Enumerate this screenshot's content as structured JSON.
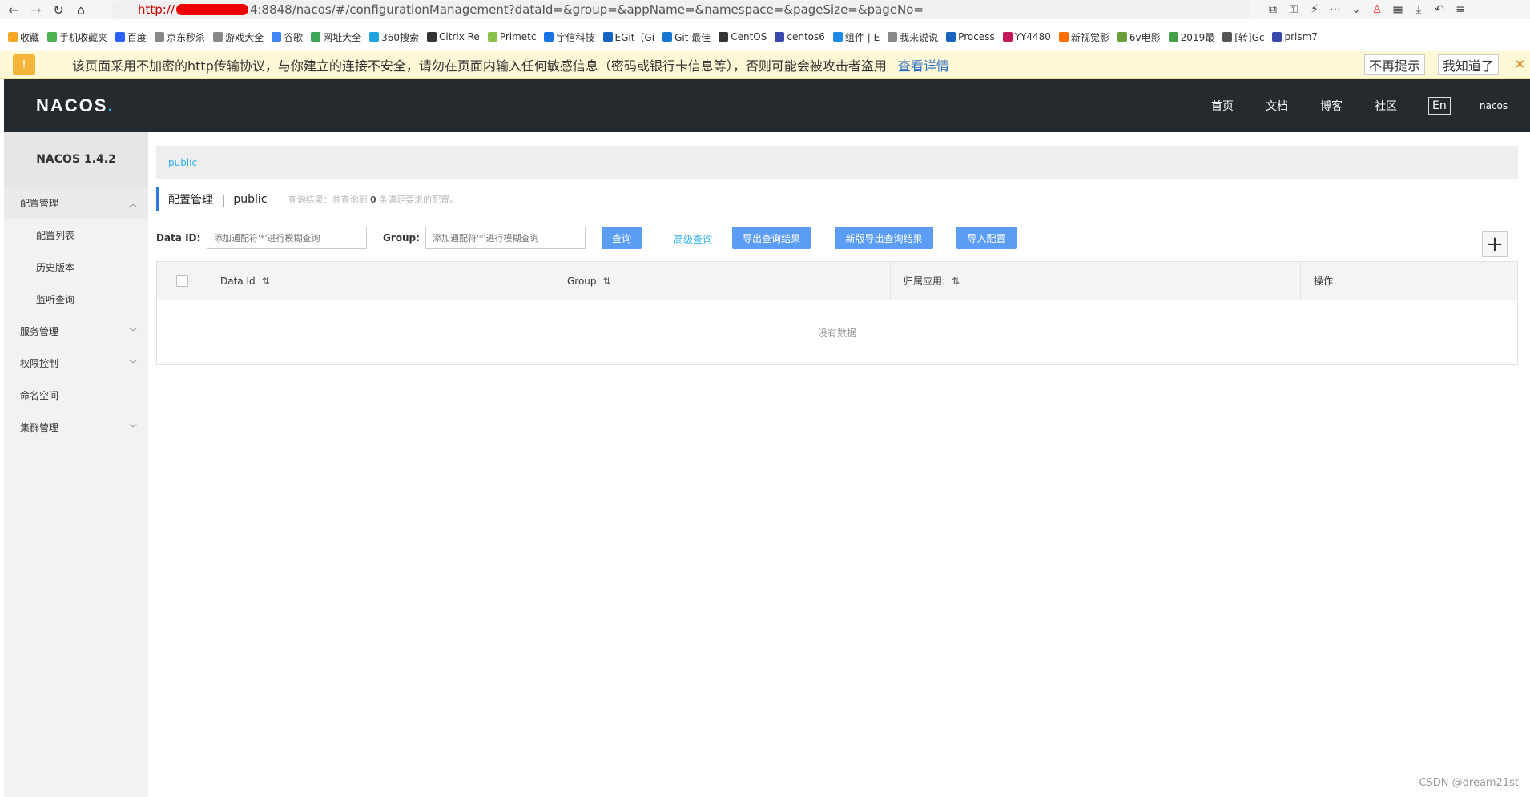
{
  "browser": {
    "url_protocol": "http://",
    "url_rest": "4:8848/nacos/#/configurationManagement?dataId=&group=&appName=&namespace=&pageSize=&pageNo="
  },
  "bookmarks": [
    "收藏",
    "手机收藏夹",
    "百度",
    "京东秒杀",
    "游戏大全",
    "谷歌",
    "网址大全",
    "360搜索",
    "Citrix Re",
    "Primetc",
    "宇信科技",
    "EGit（Gi",
    "Git 最佳",
    "CentOS",
    "centos6",
    "组件 | E",
    "我来说说",
    "Process",
    "YY4480",
    "新视觉影",
    "6v电影",
    "2019最",
    "[转]Gc",
    "prism7"
  ],
  "warning": {
    "text": "该页面采用不加密的http传输协议，与你建立的连接不安全，请勿在页面内输入任何敏感信息（密码或银行卡信息等），否则可能会被攻击者盗用",
    "link": "查看详情",
    "btn_no_remind": "不再提示",
    "btn_ok": "我知道了",
    "close": "×"
  },
  "header": {
    "logo": "NACOS",
    "logo_dot": ".",
    "nav": [
      "首页",
      "文档",
      "博客",
      "社区"
    ],
    "lang": "En",
    "user": "nacos"
  },
  "sidebar": {
    "version": "NACOS 1.4.2",
    "items": [
      {
        "label": "配置管理",
        "level": 1,
        "chev": "︿"
      },
      {
        "label": "配置列表",
        "level": 2
      },
      {
        "label": "历史版本",
        "level": 2
      },
      {
        "label": "监听查询",
        "level": 2
      },
      {
        "label": "服务管理",
        "level": 1,
        "chev": "﹀"
      },
      {
        "label": "权限控制",
        "level": 1,
        "chev": "﹀"
      },
      {
        "label": "命名空间",
        "level": 1
      },
      {
        "label": "集群管理",
        "level": 1,
        "chev": "﹀"
      }
    ]
  },
  "main": {
    "namespace_tab": "public",
    "title": "配置管理",
    "title_sep": "|",
    "title_ns": "public",
    "hint_pre": "查询结果：共查询到",
    "hint_count": "0",
    "hint_post": "条满足要求的配置。",
    "dataid_label": "Data ID:",
    "dataid_placeholder": "添加通配符'*'进行模糊查询",
    "group_label": "Group:",
    "group_placeholder": "添加通配符'*'进行模糊查询",
    "btn_query": "查询",
    "link_advanced": "高级查询",
    "btn_export": "导出查询结果",
    "btn_export_new": "新版导出查询结果",
    "btn_import": "导入配置",
    "plus": "+"
  },
  "table": {
    "columns": [
      "Data Id",
      "Group",
      "归属应用:",
      "操作"
    ],
    "sort_icon": "⇅",
    "empty_text": "没有数据"
  },
  "watermark": "CSDN @dream21st"
}
